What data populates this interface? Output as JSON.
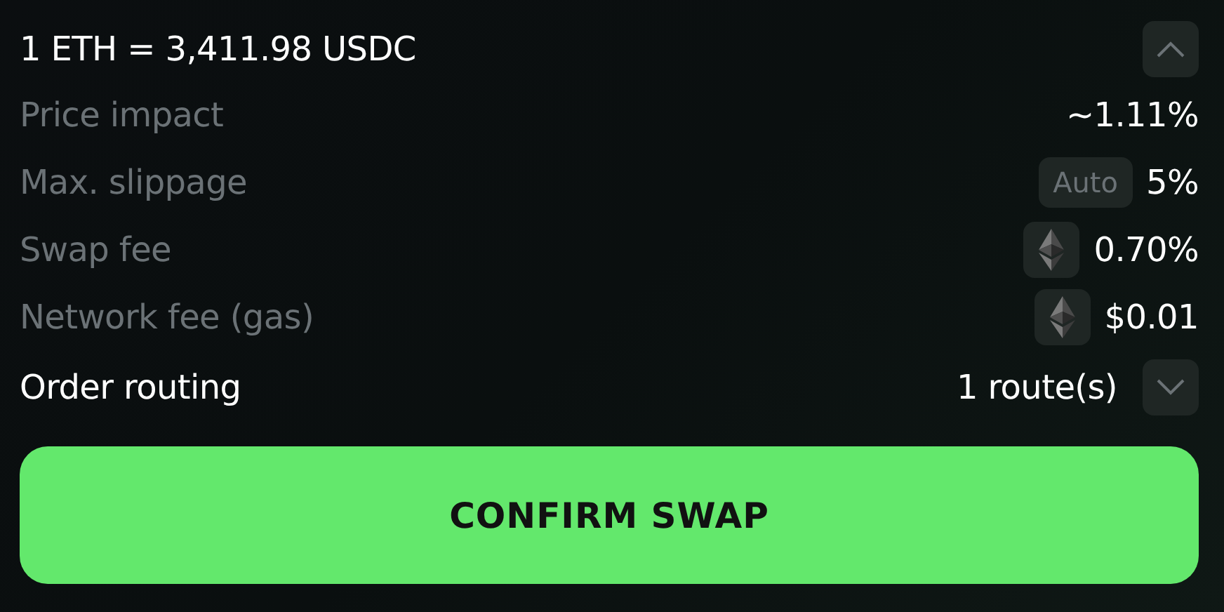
{
  "rate": {
    "text": "1 ETH = 3,411.98 USDC",
    "expanded": true
  },
  "details": [
    {
      "kind": "plain",
      "label": "Price impact",
      "value": "~1.11%"
    },
    {
      "kind": "badge",
      "label": "Max. slippage",
      "badge": "Auto",
      "value": "5%"
    },
    {
      "kind": "token",
      "label": "Swap fee",
      "value": "0.70%"
    },
    {
      "kind": "token",
      "label": "Network fee (gas)",
      "value": "$0.01"
    }
  ],
  "routing": {
    "label": "Order routing",
    "value": "1 route(s)",
    "expanded": false
  },
  "confirm_button": "CONFIRM SWAP"
}
